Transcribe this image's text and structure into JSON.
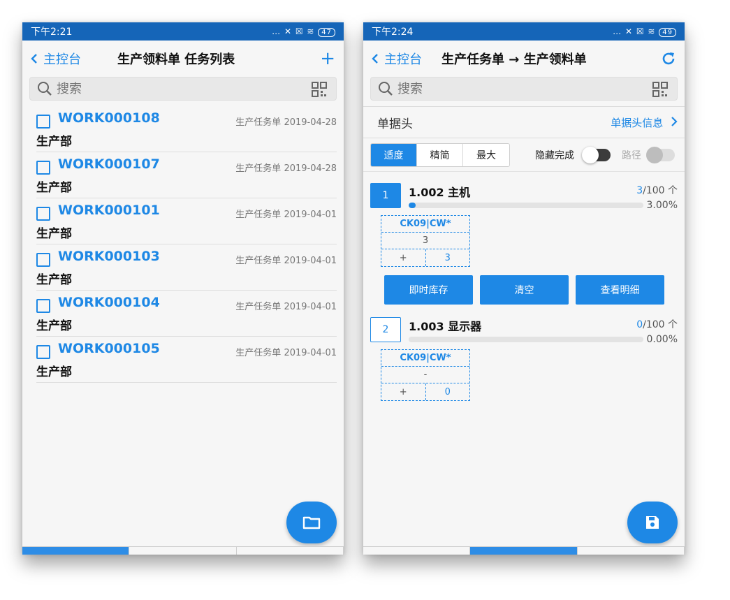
{
  "left": {
    "status": {
      "time": "下午2:21",
      "battery": "47"
    },
    "nav": {
      "back_label": "主控台",
      "title": "生产领料单 任务列表",
      "action": "+"
    },
    "search": {
      "placeholder": "搜索"
    },
    "items": [
      {
        "code": "WORK000108",
        "type": "生产任务单",
        "date": "2019-04-28",
        "dept": "生产部"
      },
      {
        "code": "WORK000107",
        "type": "生产任务单",
        "date": "2019-04-28",
        "dept": "生产部"
      },
      {
        "code": "WORK000101",
        "type": "生产任务单",
        "date": "2019-04-01",
        "dept": "生产部"
      },
      {
        "code": "WORK000103",
        "type": "生产任务单",
        "date": "2019-04-01",
        "dept": "生产部"
      },
      {
        "code": "WORK000104",
        "type": "生产任务单",
        "date": "2019-04-01",
        "dept": "生产部"
      },
      {
        "code": "WORK000105",
        "type": "生产任务单",
        "date": "2019-04-01",
        "dept": "生产部"
      }
    ]
  },
  "right": {
    "status": {
      "time": "下午2:24",
      "battery": "49"
    },
    "nav": {
      "back_label": "主控台",
      "title": "生产任务单 → 生产领料单"
    },
    "search": {
      "placeholder": "搜索"
    },
    "header_section": {
      "label": "单据头",
      "link": "单据头信息"
    },
    "segments": [
      "适度",
      "精简",
      "最大"
    ],
    "toggles": {
      "hide_done": "隐藏完成",
      "path": "路径"
    },
    "materials": [
      {
        "index": "1",
        "name": "1.002 主机",
        "qty_done": "3",
        "qty_total": "/100 个",
        "progress": 0.03,
        "percent": "3.00%",
        "location": "CK09|CW*",
        "loc_qty": "3",
        "plus": "+",
        "input_val": "3"
      },
      {
        "index": "2",
        "name": "1.003 显示器",
        "qty_done": "0",
        "qty_total": "/100 个",
        "progress": 0.0,
        "percent": "0.00%",
        "location": "CK09|CW*",
        "loc_qty": "-",
        "plus": "+",
        "input_val": "0"
      }
    ],
    "buttons": {
      "stock": "即时库存",
      "clear": "清空",
      "detail": "查看明细"
    }
  },
  "colors": {
    "accent": "#1e88e5",
    "status_bar": "#1565b8"
  }
}
